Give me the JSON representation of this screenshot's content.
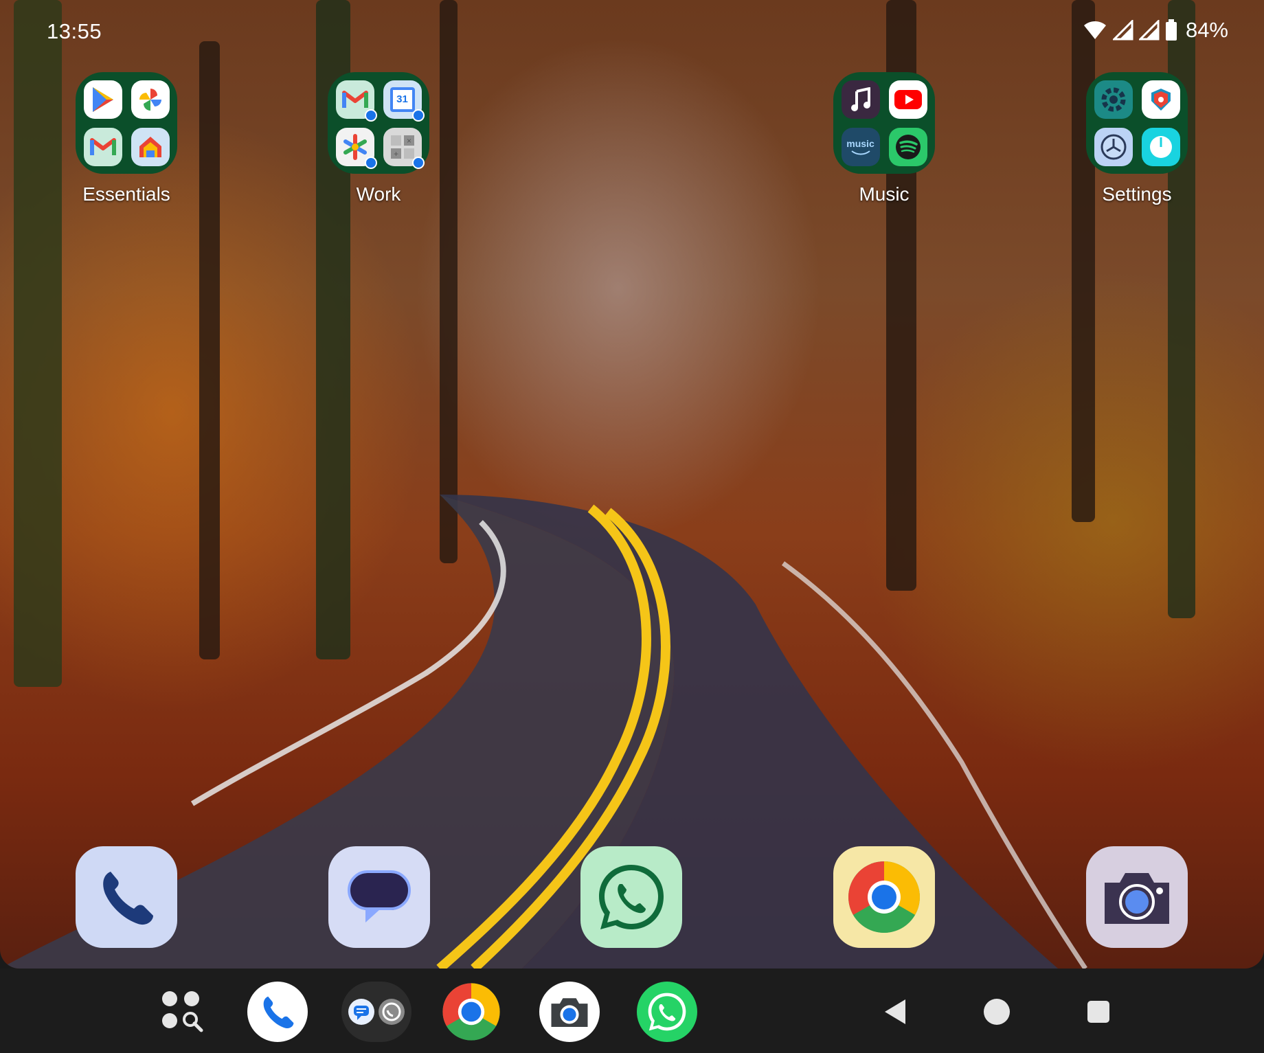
{
  "status_bar": {
    "time": "13:55",
    "battery_percent": "84%",
    "icons": [
      "wifi-icon",
      "signal-icon",
      "signal-icon",
      "battery-icon"
    ]
  },
  "folders": [
    {
      "label": "Essentials",
      "apps": [
        "play-store-icon",
        "photos-icon",
        "gmail-icon",
        "home-icon"
      ]
    },
    {
      "label": "Work",
      "apps": [
        "gmail-work-icon",
        "calendar-work-icon",
        "slack-work-icon",
        "calculator-work-icon"
      ],
      "calendar_day": "31"
    },
    {
      "label": "Music",
      "apps": [
        "apple-music-icon",
        "youtube-icon",
        "amazon-music-icon",
        "spotify-icon"
      ],
      "amazon_text": "music"
    },
    {
      "label": "Settings",
      "apps": [
        "settings-icon",
        "security-icon",
        "clock-icon",
        "timer-icon"
      ]
    }
  ],
  "dock": [
    "phone-icon",
    "messages-icon",
    "whatsapp-icon",
    "chrome-icon",
    "camera-icon"
  ],
  "taskbar": [
    "app-drawer-icon",
    "phone-icon",
    "messages-whatsapp-pair-icon",
    "chrome-icon",
    "camera-icon",
    "whatsapp-icon"
  ],
  "navigation": [
    "back-icon",
    "home-icon",
    "recents-icon"
  ],
  "colors": {
    "folder_bg": "#0b4f2a",
    "nav_bg": "#1c1c1c",
    "dock_phone": "#cfd9f5",
    "dock_messages": "#d6dcf5",
    "dock_whatsapp": "#b8ebc8",
    "dock_chrome": "#f6e7a6",
    "dock_camera": "#d7cfe0"
  }
}
